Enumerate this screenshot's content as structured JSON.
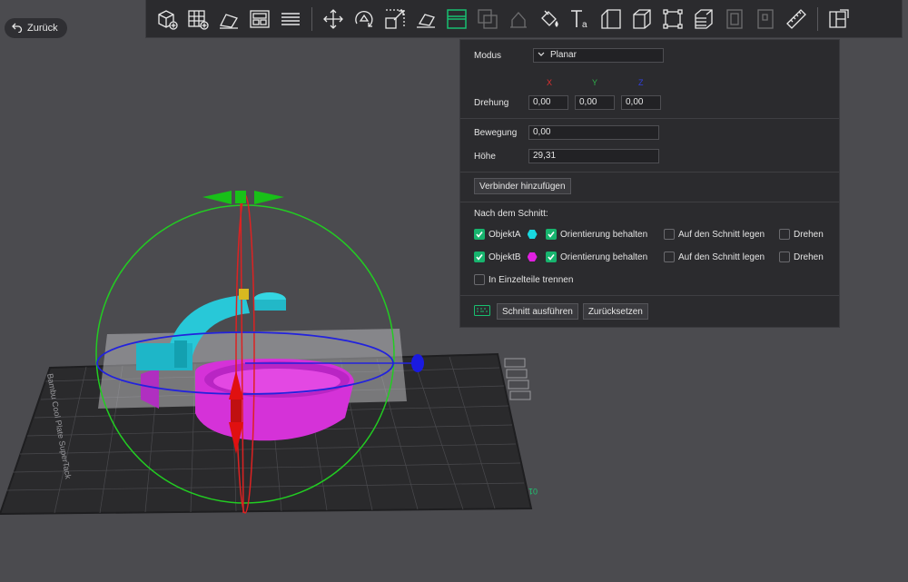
{
  "back_button": {
    "label": "Zurück"
  },
  "toolbar": {
    "items": [
      "add-object",
      "arrange",
      "auto-orient",
      "plate-layout",
      "layers",
      "move",
      "rotate",
      "scale",
      "lay-on-face",
      "cut",
      "mesh-boolean",
      "support-paint",
      "seam-paint",
      "text",
      "assemble",
      "cube",
      "bounding",
      "variable-layer",
      "split-parts",
      "split-objects",
      "measure",
      "settings"
    ],
    "active": "cut"
  },
  "cut_panel": {
    "mode_label": "Modus",
    "mode_value": "Planar",
    "axis_x": "X",
    "axis_y": "Y",
    "axis_z": "Z",
    "axis_colors": {
      "x": "#e03030",
      "y": "#2fb04a",
      "z": "#3040e0"
    },
    "rotation_label": "Drehung",
    "rotation_x": "0,00",
    "rotation_y": "0,00",
    "rotation_z": "0,00",
    "movement_label": "Bewegung",
    "movement_value": "0,00",
    "height_label": "Höhe",
    "height_value": "29,31",
    "add_connector_label": "Verbinder hinzufügen",
    "after_cut_label": "Nach dem Schnitt:",
    "object_a": {
      "label": "ObjektA",
      "color": "#18d8e0",
      "keep_orientation": "Orientierung behalten",
      "place_on_cut": "Auf den Schnitt legen",
      "flip": "Drehen"
    },
    "object_b": {
      "label": "ObjektB",
      "color": "#e020e0",
      "keep_orientation": "Orientierung behalten",
      "place_on_cut": "Auf den Schnitt legen",
      "flip": "Drehen"
    },
    "split_parts_label": "In Einzelteile trennen",
    "execute_label": "Schnitt ausführen",
    "reset_label": "Zurücksetzen"
  },
  "plate": {
    "label_left": "Bambu Cool Plate SuperTack",
    "label_right": "01"
  }
}
